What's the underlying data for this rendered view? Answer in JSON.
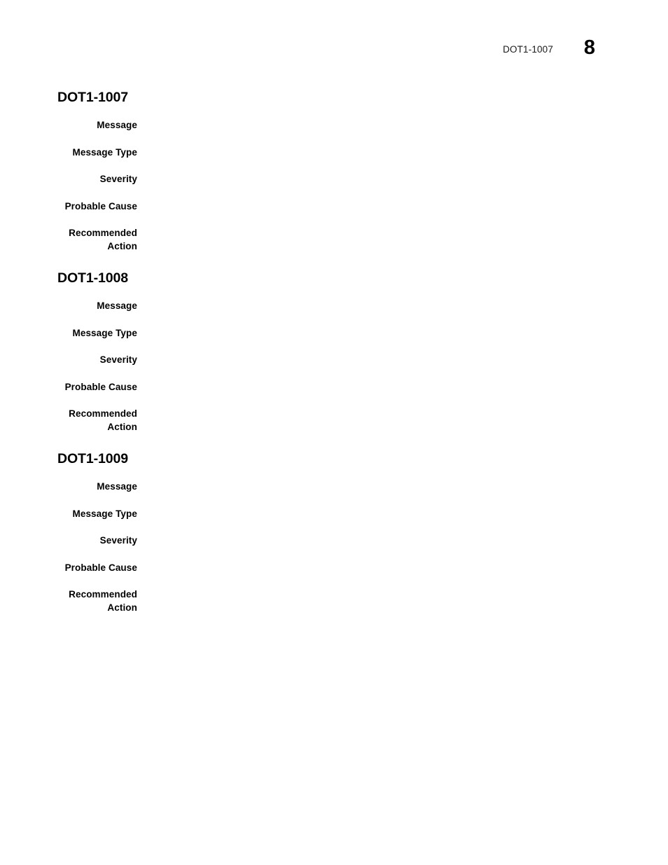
{
  "header": {
    "running_title": "DOT1-1007",
    "page_number": "8"
  },
  "sections": [
    {
      "heading": "DOT1-1007",
      "fields": [
        {
          "label": "Message",
          "value": ""
        },
        {
          "label": "Message Type",
          "value": ""
        },
        {
          "label": "Severity",
          "value": ""
        },
        {
          "label": "Probable Cause",
          "value": ""
        },
        {
          "label": "Recommended\nAction",
          "value": ""
        }
      ]
    },
    {
      "heading": "DOT1-1008",
      "fields": [
        {
          "label": "Message",
          "value": ""
        },
        {
          "label": "Message Type",
          "value": ""
        },
        {
          "label": "Severity",
          "value": ""
        },
        {
          "label": "Probable Cause",
          "value": ""
        },
        {
          "label": "Recommended\nAction",
          "value": ""
        }
      ]
    },
    {
      "heading": "DOT1-1009",
      "fields": [
        {
          "label": "Message",
          "value": ""
        },
        {
          "label": "Message Type",
          "value": ""
        },
        {
          "label": "Severity",
          "value": ""
        },
        {
          "label": "Probable Cause",
          "value": ""
        },
        {
          "label": "Recommended\nAction",
          "value": ""
        }
      ]
    }
  ]
}
